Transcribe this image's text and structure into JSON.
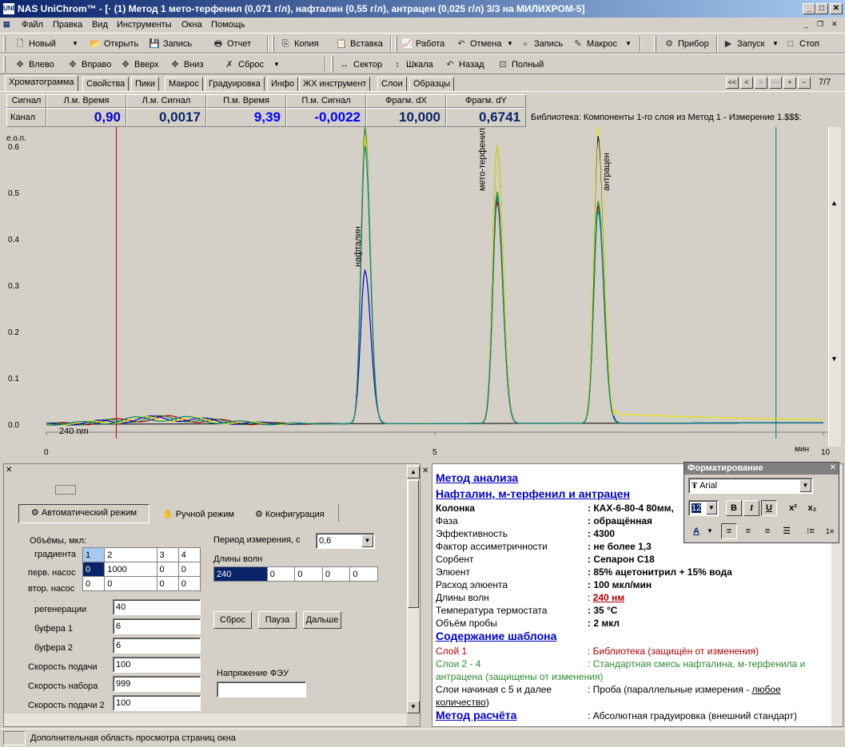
{
  "title": "NAS UniChrom™ - [· (1) Метод 1 мето-терфенил (0,071 г/л), нафталин (0,55 г/л), антрацен (0,025 г/л) 3/3  на  МИЛИХРОМ-5]",
  "app_icon_text": "UNI",
  "menu": [
    "Файл",
    "Правка",
    "Вид",
    "Инструменты",
    "Окна",
    "Помощь"
  ],
  "toolbar1": {
    "new": "Новый",
    "open": "Открыть",
    "save": "Запись",
    "report": "Отчет",
    "copy": "Копия",
    "paste": "Вставка",
    "work": "Работа",
    "undo": "Отмена",
    "record": "Запись",
    "macro": "Макрос",
    "device": "Прибор",
    "launch": "Запуск",
    "stop": "Стоп"
  },
  "toolbar2": {
    "left": "Влево",
    "right": "Вправо",
    "up": "Вверх",
    "down": "Вниз",
    "reset": "Сброс",
    "sector": "Сектор",
    "scale": "Шкала",
    "back": "Назад",
    "full": "Полный"
  },
  "tabs": [
    "Хроматограмма",
    "Свойства",
    "Пики",
    "Макрос",
    "Градуировка",
    "Инфо",
    "ЖХ инструмент",
    "Слои",
    "Образцы"
  ],
  "nav": {
    "first": "<<",
    "prev": "<",
    "next": ">",
    "last": ">>",
    "plus": "+",
    "minus": "−",
    "page": "7/7"
  },
  "readout": {
    "headers": [
      "Сигнал",
      "Л.м. Время",
      "Л.м. Сигнал",
      "П.м. Время",
      "П.м. Сигнал",
      "Фрагм. dX",
      "Фрагм. dY"
    ],
    "channel": "Канал 1",
    "values": [
      "0,90",
      "0,0017",
      "9,39",
      "-0,0022",
      "10,000",
      "0,6741"
    ],
    "library": "Библиотека: Компоненты 1-го слоя из Метод 1 - Измерение 1.$$$:"
  },
  "chart_data": {
    "type": "line",
    "ylabel": "е.о.п.",
    "xlabel": "мин",
    "xlim": [
      0,
      10
    ],
    "ylim": [
      0,
      0.6
    ],
    "y_ticks": [
      "0.6",
      "0.5",
      "0.4",
      "0.3",
      "0.2",
      "0.1",
      "0.0"
    ],
    "x_ticks": [
      "0",
      "5",
      "10"
    ],
    "wavelength": "240 nm",
    "left_marker_min": 0.9,
    "right_marker_min": 9.39,
    "peak_labels": [
      {
        "text": "нафталин",
        "t": 4.0
      },
      {
        "text": "мето-терфенил",
        "t": 5.6
      },
      {
        "text": "антрацен",
        "t": 7.2
      }
    ],
    "series": [
      {
        "color": "#b00000",
        "peaks": [
          [
            4.1,
            0.62,
            0.1
          ],
          [
            5.8,
            0.48,
            0.11
          ],
          [
            7.1,
            0.47,
            0.11
          ]
        ]
      },
      {
        "color": "#2e8b2e",
        "peaks": [
          [
            4.1,
            0.64,
            0.1
          ],
          [
            5.8,
            0.5,
            0.11
          ],
          [
            7.1,
            0.48,
            0.11
          ]
        ]
      },
      {
        "color": "#0000cc",
        "peaks": [
          [
            4.1,
            0.33,
            0.11
          ],
          [
            5.8,
            0.6,
            0.11
          ],
          [
            7.1,
            0.62,
            0.11
          ]
        ]
      },
      {
        "color": "#e6e600",
        "peaks": [
          [
            4.1,
            0.62,
            0.1
          ],
          [
            5.8,
            0.6,
            0.11
          ],
          [
            7.1,
            0.64,
            0.11
          ]
        ]
      },
      {
        "color": "#008080",
        "peaks": [
          [
            4.1,
            0.6,
            0.1
          ],
          [
            5.8,
            0.49,
            0.11
          ],
          [
            7.1,
            0.46,
            0.11
          ]
        ]
      }
    ]
  },
  "panel_left": {
    "status_box": "",
    "modes": [
      "Автоматический режим",
      "Ручной режим",
      "Конфигурация"
    ],
    "volumes_label": "Объёмы, мкл:",
    "grid_row_labels": [
      "градиента",
      "перв. насос",
      "втор. насос"
    ],
    "grid_header": [
      "1",
      "2",
      "3",
      "4"
    ],
    "grid_row1": [
      "0",
      "1000",
      "0",
      "0"
    ],
    "grid_row2": [
      "0",
      "0",
      "0",
      "0"
    ],
    "params": [
      {
        "label": "регенерации",
        "value": "40"
      },
      {
        "label": "буфера 1",
        "value": "6"
      },
      {
        "label": "буфера 2",
        "value": "6"
      },
      {
        "label": "Скорость подачи",
        "value": "100"
      },
      {
        "label": "Скорость набора",
        "value": "999"
      },
      {
        "label": "Скорость подачи 2",
        "value": "100"
      }
    ],
    "period_label": "Период измерения, с",
    "period_value": "0,6",
    "wave_label": "Длины волн",
    "waves": [
      "240",
      "0",
      "0",
      "0",
      "0"
    ],
    "buttons": [
      "Сброс",
      "Пауза",
      "Дальше"
    ],
    "pmt_label": "Напряжение ФЭУ",
    "pmt_value": ""
  },
  "panel_right": {
    "h1": "Метод анализа",
    "h2": "Нафталин, м-терфенил и антрацен",
    "rows": [
      {
        "k": "Колонка",
        "v": ": КАХ-6-80-4 80мм,",
        "kb": true
      },
      {
        "k": "Фаза",
        "v": ": обращённая"
      },
      {
        "k": "Эффективность",
        "v": ": 4300"
      },
      {
        "k": "Фактор ассиметричности",
        "v": ": не более 1,3"
      },
      {
        "k": "Сорбент",
        "v": ": Сепарон С18"
      },
      {
        "k": "Элюент",
        "v": ": 85% ацетонитрил + 15% вода"
      },
      {
        "k": "Расход элюента",
        "v": ": 100 мкл/мин"
      },
      {
        "k": "Длины волн",
        "v_prefix": ": ",
        "v_link": "240 нм"
      },
      {
        "k": "Температура термостата",
        "v": ": 35 °C"
      },
      {
        "k": "Объём пробы",
        "v": ": 2 мкл"
      }
    ],
    "h3": "Содержание шаблона",
    "layer1_k": "Слой 1",
    "layer1_v": ": Библиотека      (защищён от изменения)",
    "layer24_k": "Слои 2 - 4",
    "layer24_v": ": Стандартная смесь нафталина, м-терфенила и",
    "layer24_v2": "антрацена         (защищены от изменения)",
    "layer5_k": "Слои начиная с 5 и далее",
    "layer5_v": ": Проба (параллельные измерения - ",
    "layer5_link": "любое",
    "layer5_v2": "количество",
    "layer5_v3": ")",
    "h4": "Метод расчёта",
    "calc_v": ": Абсолютная градуировка (внешний стандарт)"
  },
  "format_panel": {
    "title": "Форматирование",
    "font": "Arial",
    "size": "12",
    "bold": "B",
    "italic": "I",
    "underline": "U",
    "sup": "x²",
    "sub": "x₂",
    "color_a": "A"
  },
  "status": "Дополнительная область просмотра страниц окна"
}
